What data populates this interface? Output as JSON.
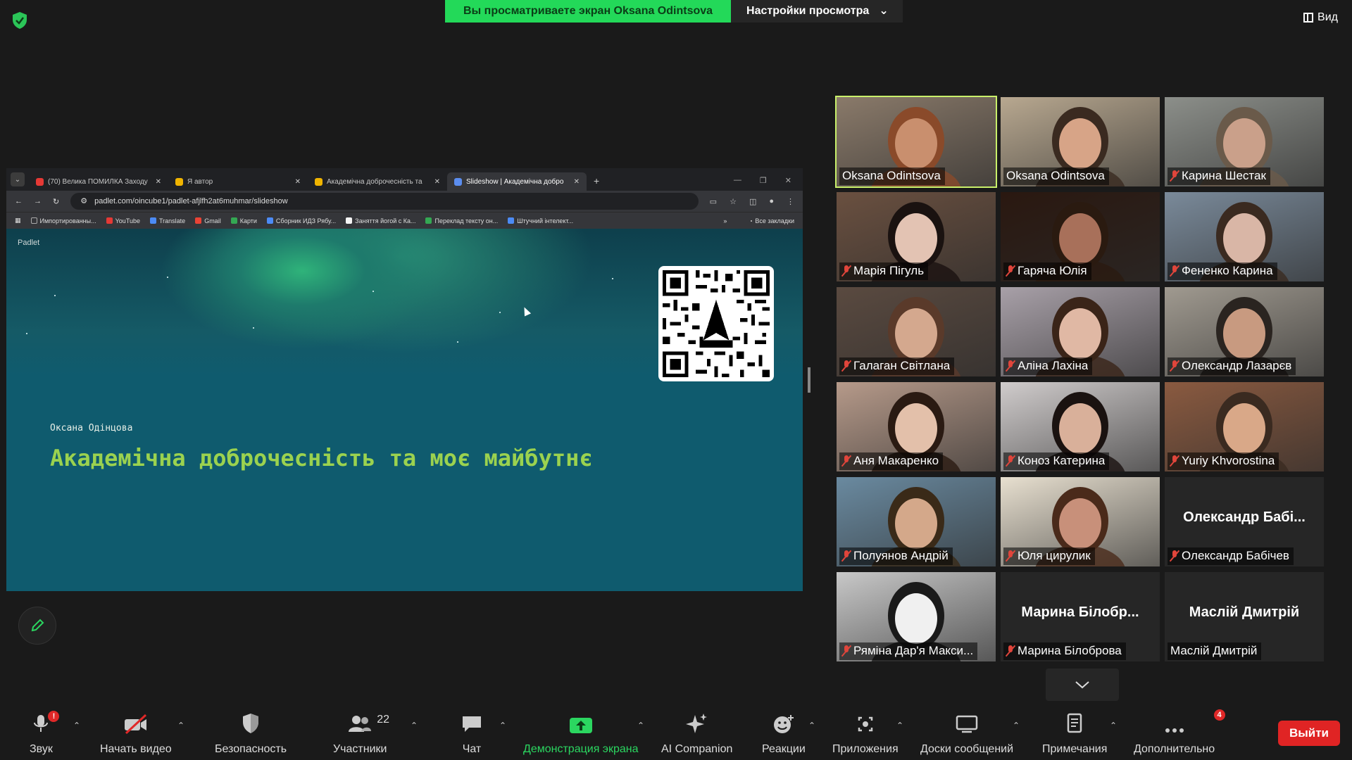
{
  "banner": {
    "viewing_text": "Вы просматриваете экран Oksana Odintsova",
    "settings_label": "Настройки просмотра",
    "view_label": "Вид"
  },
  "browser": {
    "tabs": [
      {
        "title": "(70) Велика ПОМИЛКА Заходу",
        "icon_color": "#e53935",
        "active": false
      },
      {
        "title": "Я автор",
        "icon_color": "#f0b400",
        "active": false
      },
      {
        "title": "Академічна доброчесність та",
        "icon_color": "#f0b400",
        "active": false
      },
      {
        "title": "Slideshow | Академічна добро",
        "icon_color": "#5b8def",
        "active": true
      }
    ],
    "new_tab": "+",
    "url": "padlet.com/oincube1/padlet-afjlfh2at6muhmar/slideshow",
    "bookmarks": [
      {
        "label": "Импортированны...",
        "icon_color": "#aaaaaa"
      },
      {
        "label": "YouTube",
        "icon_color": "#e53935"
      },
      {
        "label": "Translate",
        "icon_color": "#4c8bf5"
      },
      {
        "label": "Gmail",
        "icon_color": "#ea4335"
      },
      {
        "label": "Карти",
        "icon_color": "#34a853"
      },
      {
        "label": "Сборник ИДЗ Рябу...",
        "icon_color": "#4c8bf5"
      },
      {
        "label": "Заняття йогой с Ка...",
        "icon_color": "#f5f5f5"
      },
      {
        "label": "Переклад тексту он...",
        "icon_color": "#34a853"
      },
      {
        "label": "Штучний інтелект...",
        "icon_color": "#4c8bf5"
      }
    ],
    "more_bookmarks": "»",
    "all_bookmarks": "Все закладки"
  },
  "slide": {
    "brand": "Padlet",
    "author": "Оксана Одінцова",
    "title": "Академічна доброчесність та моє майбутнє"
  },
  "participants": [
    {
      "name": "Oksana Odintsova",
      "muted": false,
      "video": true,
      "speaking": true,
      "bg": "#8a7a6a",
      "skin": "#c98f6e",
      "hair": "#8a4a2a"
    },
    {
      "name": "Oksana Odintsova",
      "muted": false,
      "video": true,
      "speaking": false,
      "bg": "#b8a890",
      "skin": "#d7a487",
      "hair": "#3a2a20"
    },
    {
      "name": "Карина Шестак",
      "muted": true,
      "video": true,
      "speaking": false,
      "bg": "#8c8f8a",
      "skin": "#caa08a",
      "hair": "#6a5a4a"
    },
    {
      "name": "Марія Пігуль",
      "muted": true,
      "video": true,
      "speaking": false,
      "bg": "#6a5040",
      "skin": "#e3c3b3",
      "hair": "#1a1210"
    },
    {
      "name": "Гаряча Юлія",
      "muted": true,
      "video": true,
      "speaking": false,
      "bg": "#2a1810",
      "skin": "#a8705a",
      "hair": "#2a1a10"
    },
    {
      "name": "Фененко Карина",
      "muted": true,
      "video": true,
      "speaking": false,
      "bg": "#7a8a9a",
      "skin": "#d9b6a6",
      "hair": "#3a2a20"
    },
    {
      "name": "Галаган Світлана",
      "muted": true,
      "video": true,
      "speaking": false,
      "bg": "#5a4a40",
      "skin": "#d4a88e",
      "hair": "#5a3a2a"
    },
    {
      "name": "Аліна Лахіна",
      "muted": true,
      "video": true,
      "speaking": false,
      "bg": "#a8a0a8",
      "skin": "#e0b8a4",
      "hair": "#3a2418"
    },
    {
      "name": "Олександр Лазарєв",
      "muted": true,
      "video": true,
      "speaking": false,
      "bg": "#a09a90",
      "skin": "#c89a80",
      "hair": "#2a2420"
    },
    {
      "name": "Аня Макаренко",
      "muted": true,
      "video": true,
      "speaking": false,
      "bg": "#b69a8a",
      "skin": "#e3c0aa",
      "hair": "#2a1a12"
    },
    {
      "name": "Коноз Катерина",
      "muted": true,
      "video": true,
      "speaking": false,
      "bg": "#d0cccc",
      "skin": "#d9b09a",
      "hair": "#1a1210"
    },
    {
      "name": "Yuriy Khvorostina",
      "muted": true,
      "video": true,
      "speaking": false,
      "bg": "#8a5a40",
      "skin": "#d9a888",
      "hair": "#3a2a20"
    },
    {
      "name": "Полуянов Андрій",
      "muted": true,
      "video": true,
      "speaking": false,
      "bg": "#6a8aa0",
      "skin": "#d4a88a",
      "hair": "#3a2a18"
    },
    {
      "name": "Юля цирулик",
      "muted": true,
      "video": true,
      "speaking": false,
      "bg": "#e8e0d0",
      "skin": "#c8907a",
      "hair": "#4a2a1a"
    },
    {
      "name": "Олександр Бабічев",
      "muted": true,
      "video": false,
      "speaking": false,
      "center_name": "Олександр Бабі..."
    },
    {
      "name": "Ряміна Дар'я Макси...",
      "muted": true,
      "video": true,
      "speaking": false,
      "bg": "#c8c8c8",
      "skin": "#f0f0f0",
      "hair": "#1a1a1a"
    },
    {
      "name": "Марина Білоброва",
      "muted": true,
      "video": false,
      "speaking": false,
      "center_name": "Марина Білобр..."
    },
    {
      "name": "Маслій Дмитрій",
      "muted": false,
      "video": false,
      "speaking": false,
      "center_name": "Маслій Дмитрій"
    }
  ],
  "toolbar": {
    "audio": {
      "label": "Звук",
      "badge": "!"
    },
    "video": {
      "label": "Начать видео"
    },
    "security": {
      "label": "Безопасность"
    },
    "participants": {
      "label": "Участники",
      "count": "22"
    },
    "chat": {
      "label": "Чат"
    },
    "share": {
      "label": "Демонстрация экрана"
    },
    "ai": {
      "label": "AI Companion"
    },
    "reactions": {
      "label": "Реакции"
    },
    "apps": {
      "label": "Приложения"
    },
    "boards": {
      "label": "Доски сообщений"
    },
    "notes": {
      "label": "Примечания"
    },
    "more": {
      "label": "Дополнительно",
      "badge": "4"
    },
    "leave": {
      "label": "Выйти"
    }
  },
  "colors": {
    "share_green": "#23d959",
    "speaking_outline": "#c9f06a",
    "leave_red": "#e02424",
    "slide_bg": "#0f5b6e",
    "slide_title": "#9bd24f"
  }
}
